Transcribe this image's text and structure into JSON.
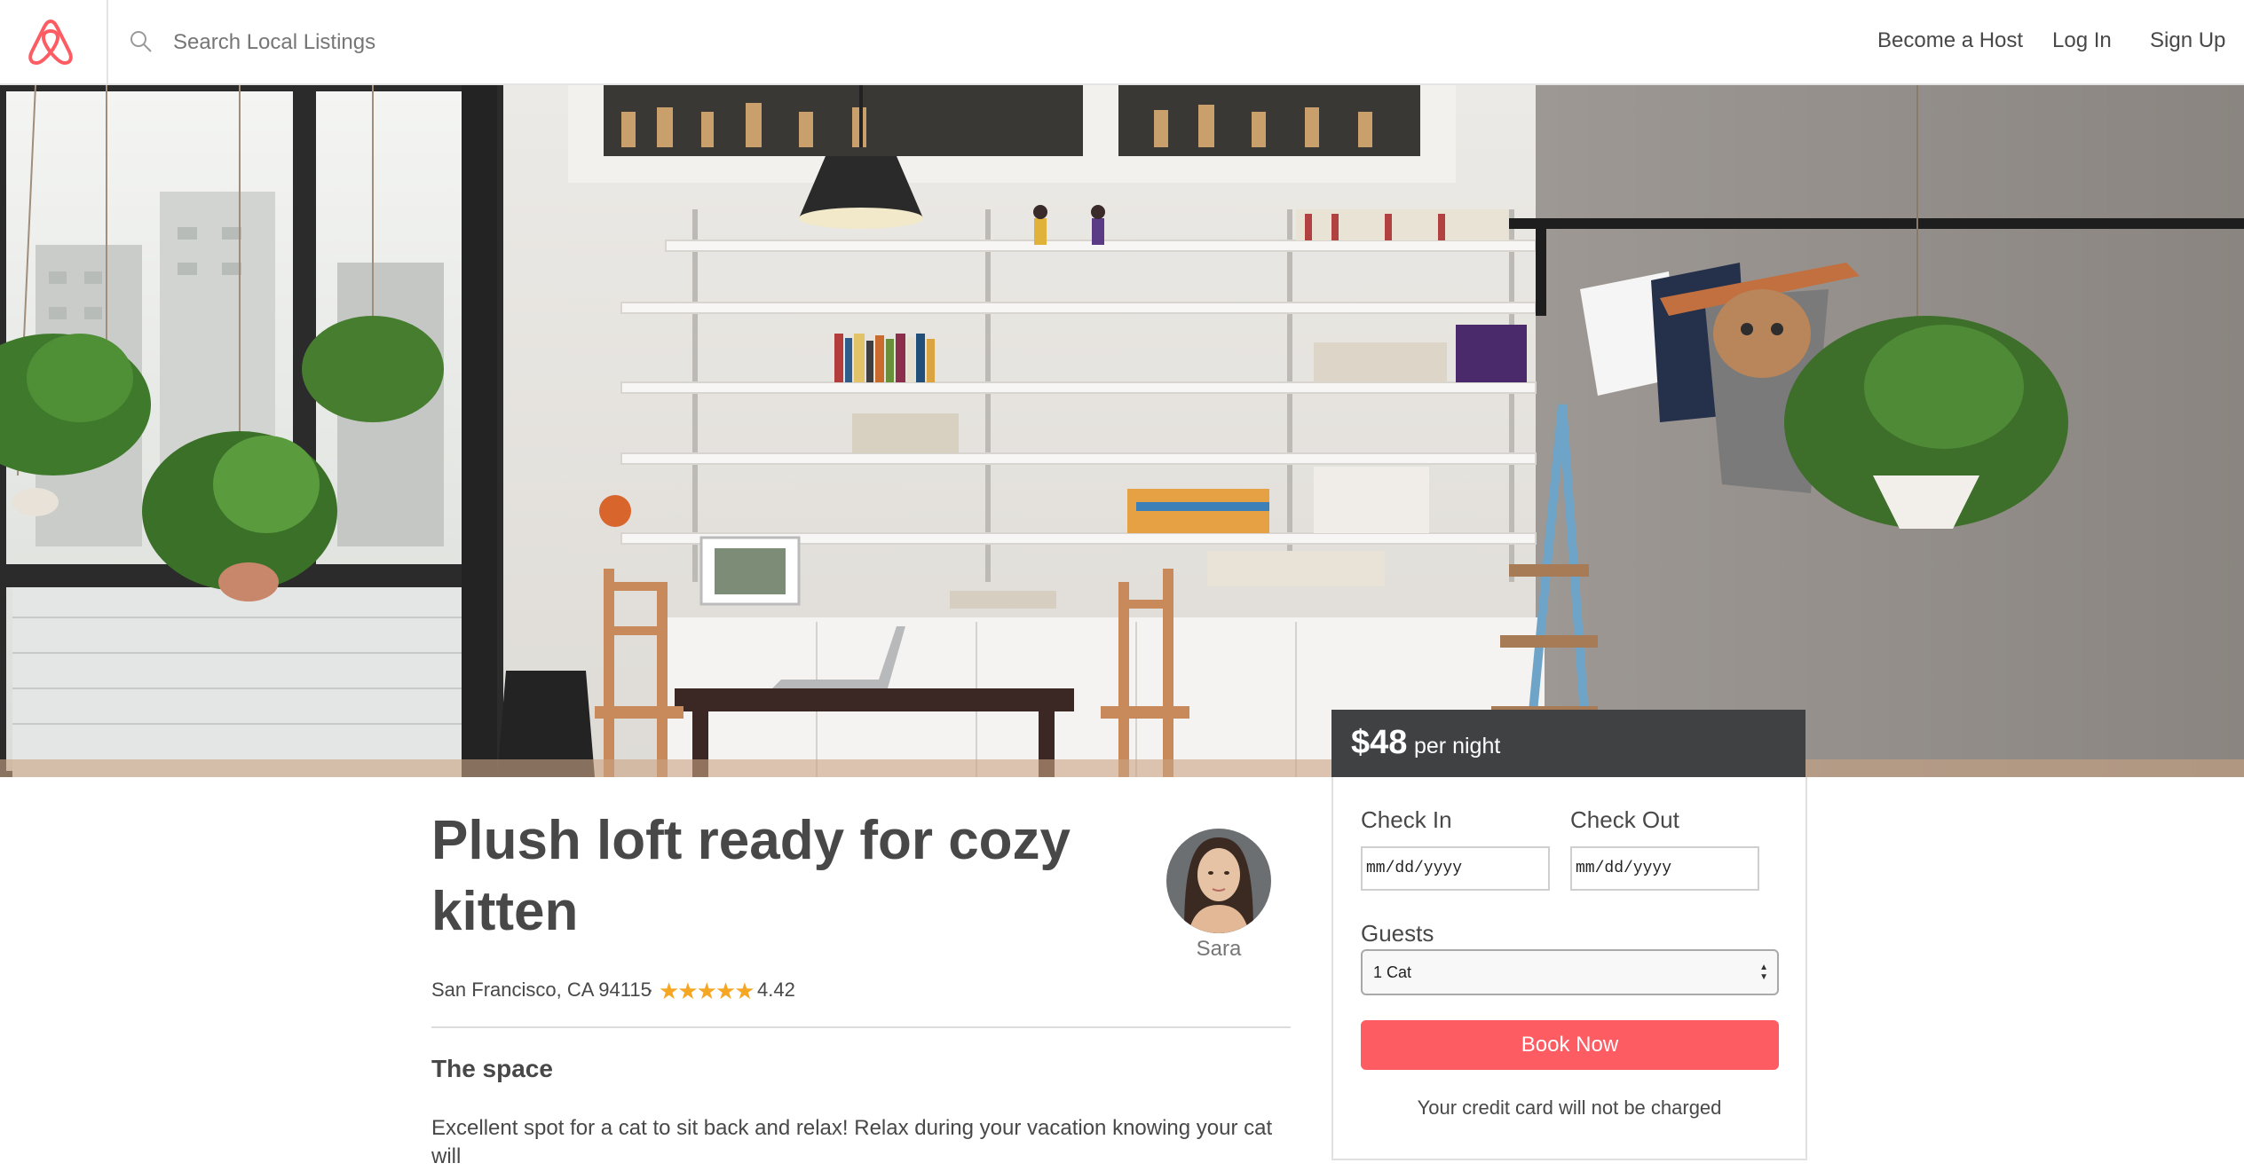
{
  "header": {
    "search_placeholder": "Search Local Listings",
    "nav": {
      "become_host": "Become a Host",
      "log_in": "Log In",
      "sign_up": "Sign Up"
    },
    "brand_color": "#FD5C63"
  },
  "booking": {
    "price": "$48",
    "price_unit": "per night",
    "check_in_label": "Check In",
    "check_out_label": "Check Out",
    "check_in_placeholder": "mm/dd/yyyy",
    "check_out_placeholder": "mm/dd/yyyy",
    "guests_label": "Guests",
    "guests_selected": "1 Cat",
    "book_label": "Book Now",
    "note": "Your credit card will not be charged",
    "button_color": "#FD5C63"
  },
  "listing": {
    "title": "Plush loft ready for cozy kitten",
    "host_name": "Sara",
    "location": "San Francisco, CA 94115",
    "separator": "·",
    "stars": "★★★★★",
    "rating": "4.42",
    "space_heading": "The space",
    "description": "Excellent spot for a cat to sit back and relax! Relax during your vacation knowing your cat will"
  },
  "icons": {
    "logo": "airbnb-logo-icon",
    "search": "search-icon"
  }
}
